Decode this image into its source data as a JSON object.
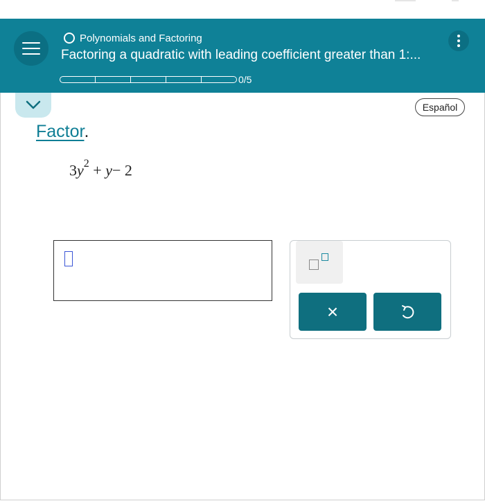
{
  "header": {
    "topic": "Polynomials and Factoring",
    "lesson": "Factoring a quadratic with leading coefficient greater than 1:...",
    "progress": {
      "completed": 0,
      "total": 5,
      "label": "0/5"
    }
  },
  "controls": {
    "language": "Español",
    "menu_icon": "hamburger-icon",
    "more_icon": "kebab-icon",
    "collapse_icon": "chevron-down-icon"
  },
  "problem": {
    "instruction_word": "Factor",
    "instruction_punct": ".",
    "expression": {
      "coef": "3",
      "var1": "y",
      "exp": "2",
      "op1": "+",
      "var2": "y",
      "op2": "−",
      "const": "2"
    }
  },
  "keypad": {
    "exponent_key_icon": "exponent-template-icon",
    "clear_symbol": "×",
    "undo_icon": "undo-icon"
  },
  "colors": {
    "header": "#0f8197",
    "accent": "#0f7e95",
    "button": "#0f6f7f",
    "collapse_tab": "#c9e8ee"
  }
}
